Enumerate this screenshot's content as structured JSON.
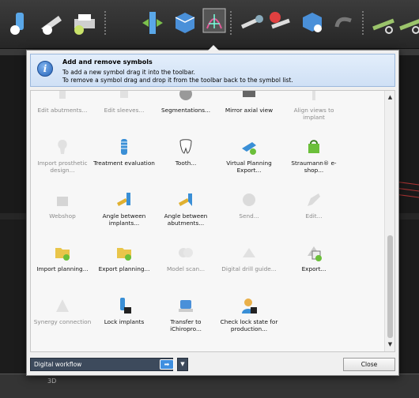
{
  "colors": {
    "accent": "#3f8fe0",
    "info_bg": "#d8e6f7",
    "dialog_bg": "#f0f0f0",
    "app_dark": "#262626"
  },
  "app": {
    "toolbar_icons": [
      "implant-tool-icon",
      "sleeve-tool-icon",
      "printer-icon",
      "axial-align-icon",
      "cube-view-icon",
      "symbol-customize-icon",
      "measure-icon",
      "remove-tool-icon",
      "shape-tool-icon",
      "undo-icon",
      "cut-tool-icon",
      "cut-tool-2-icon"
    ],
    "status_label": "3D"
  },
  "dialog": {
    "info": {
      "title": "Add and remove symbols",
      "line1": "To add a new symbol drag it into the toolbar.",
      "line2": "To remove a symbol drag and drop it from the toolbar back to the symbol list."
    },
    "symbols": [
      {
        "label": "Edit abutments...",
        "icon": "abutment-icon",
        "enabled": false
      },
      {
        "label": "Edit sleeves...",
        "icon": "sleeve-icon",
        "enabled": false
      },
      {
        "label": "Segmentations...",
        "icon": "segmentation-icon",
        "enabled": true
      },
      {
        "label": "Mirror axial view",
        "icon": "mirror-icon",
        "enabled": true
      },
      {
        "label": "Align views to implant",
        "icon": "align-views-icon",
        "enabled": false
      },
      {
        "label": "Import prosthetic design...",
        "icon": "import-prosthetic-icon",
        "enabled": false
      },
      {
        "label": "Treatment evaluation",
        "icon": "treatment-evaluation-icon",
        "enabled": true
      },
      {
        "label": "Tooth...",
        "icon": "tooth-icon",
        "enabled": true
      },
      {
        "label": "Virtual Planning Export...",
        "icon": "virtual-planning-export-icon",
        "enabled": true
      },
      {
        "label": "Straumann® e-shop...",
        "icon": "eshop-icon",
        "enabled": true
      },
      {
        "label": "Webshop",
        "icon": "webshop-icon",
        "enabled": false
      },
      {
        "label": "Angle between implants...",
        "icon": "angle-implants-icon",
        "enabled": true
      },
      {
        "label": "Angle between abutments...",
        "icon": "angle-abutments-icon",
        "enabled": true
      },
      {
        "label": "Send...",
        "icon": "send-icon",
        "enabled": false
      },
      {
        "label": "Edit...",
        "icon": "edit-icon",
        "enabled": false
      },
      {
        "label": "Import planning...",
        "icon": "import-planning-icon",
        "enabled": true
      },
      {
        "label": "Export planning...",
        "icon": "export-planning-icon",
        "enabled": true
      },
      {
        "label": "Model scan...",
        "icon": "model-scan-icon",
        "enabled": false
      },
      {
        "label": "Digital drill guide...",
        "icon": "drill-guide-icon",
        "enabled": false
      },
      {
        "label": "Export...",
        "icon": "export-icon",
        "enabled": true
      },
      {
        "label": "Synergy connection",
        "icon": "synergy-icon",
        "enabled": false
      },
      {
        "label": "Lock implants",
        "icon": "lock-implants-icon",
        "enabled": true
      },
      {
        "label": "Transfer to iChiropro...",
        "icon": "transfer-ichiropro-icon",
        "enabled": true
      },
      {
        "label": "Check lock state for production...",
        "icon": "check-lock-state-icon",
        "enabled": true
      }
    ],
    "footer": {
      "workflow_select": "Digital workflow",
      "close_label": "Close"
    }
  }
}
